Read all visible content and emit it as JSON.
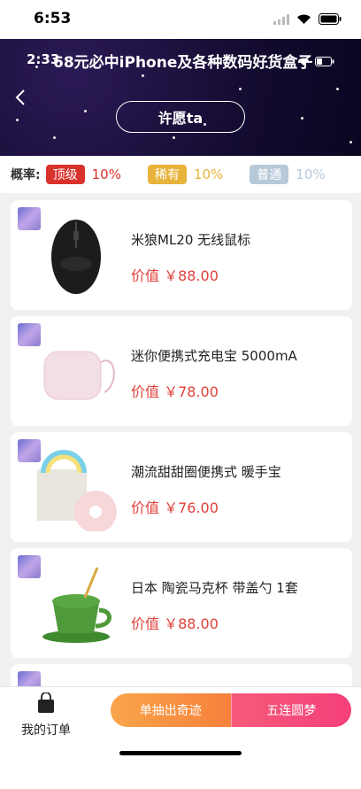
{
  "status_bar": {
    "time": "6:53"
  },
  "hero": {
    "overlay_time": "2:33",
    "title": "68元必中iPhone及各种数码好货盒子",
    "wish_button": "许愿ta",
    "background": "#140b30"
  },
  "probability": {
    "label": "概率:",
    "tiers": [
      {
        "name": "顶级",
        "percent": "10%",
        "badge_color": "#d9322d",
        "text_color": "#d9322d"
      },
      {
        "name": "稀有",
        "percent": "10%",
        "badge_color": "#e7b33b",
        "text_color": "#e7b33b"
      },
      {
        "name": "普通",
        "percent": "10%",
        "badge_color": "#b7c9d9",
        "text_color": "#b7c9d9"
      }
    ]
  },
  "items": [
    {
      "name": "米狼ML20 无线鼠标",
      "price": "价值 ￥88.00",
      "icon": "mouse"
    },
    {
      "name": "迷你便携式充电宝 5000mA",
      "price": "价值 ￥78.00",
      "icon": "power-bank"
    },
    {
      "name": "潮流甜甜圈便携式 暖手宝",
      "price": "价值 ￥76.00",
      "icon": "hand-warmer"
    },
    {
      "name": "日本 陶瓷马克杯 带盖勺 1套",
      "price": "价值 ￥88.00",
      "icon": "mug"
    }
  ],
  "bottom_nav": {
    "orders_label": "我的订单",
    "draw_one": "单抽出奇迹",
    "draw_five": "五连圆梦"
  },
  "colors": {
    "price": "#e0413a",
    "accent_orange": "#f7803c",
    "accent_pink": "#f5407a"
  }
}
